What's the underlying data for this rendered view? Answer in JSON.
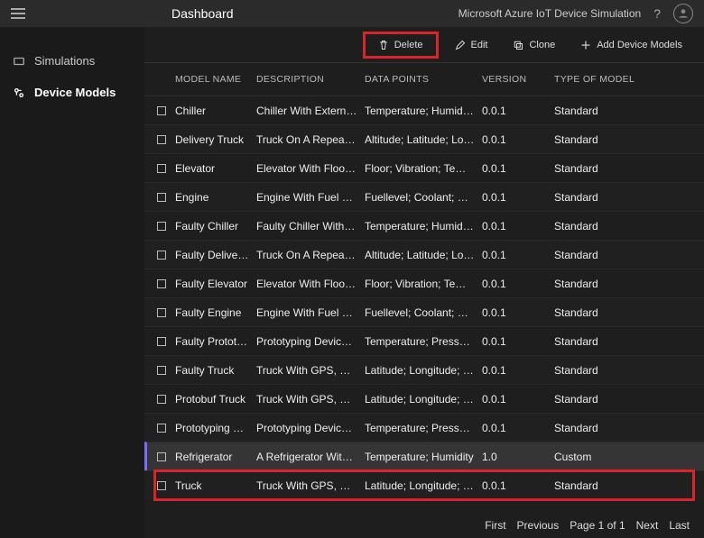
{
  "header": {
    "title": "Dashboard",
    "product": "Microsoft Azure IoT Device Simulation"
  },
  "sidebar": {
    "items": [
      {
        "label": "Simulations",
        "active": false
      },
      {
        "label": "Device Models",
        "active": true
      }
    ]
  },
  "toolbar": {
    "delete": "Delete",
    "edit": "Edit",
    "clone": "Clone",
    "add": "Add Device Models"
  },
  "columns": {
    "model": "MODEL NAME",
    "desc": "DESCRIPTION",
    "data": "DATA POINTS",
    "ver": "VERSION",
    "type": "TYPE OF MODEL"
  },
  "rows": [
    {
      "name": "Chiller",
      "desc": "Chiller With External T...",
      "data": "Temperature; Humidit...",
      "ver": "0.0.1",
      "type": "Standard",
      "selected": false
    },
    {
      "name": "Delivery Truck",
      "desc": "Truck On A Repeating...",
      "data": "Altitude; Latitude; Lon...",
      "ver": "0.0.1",
      "type": "Standard",
      "selected": false
    },
    {
      "name": "Elevator",
      "desc": "Elevator With Floor, Vi...",
      "data": "Floor; Vibration; Temp...",
      "ver": "0.0.1",
      "type": "Standard",
      "selected": false
    },
    {
      "name": "Engine",
      "desc": "Engine With Fuel Leve...",
      "data": "Fuellevel; Coolant; Vib...",
      "ver": "0.0.1",
      "type": "Standard",
      "selected": false
    },
    {
      "name": "Faulty Chiller",
      "desc": "Faulty Chiller With Wr...",
      "data": "Temperature; Humidit...",
      "ver": "0.0.1",
      "type": "Standard",
      "selected": false
    },
    {
      "name": "Faulty Delivery Tr...",
      "desc": "Truck On A Repeating...",
      "data": "Altitude; Latitude; Lon...",
      "ver": "0.0.1",
      "type": "Standard",
      "selected": false
    },
    {
      "name": "Faulty Elevator",
      "desc": "Elevator With Floor, Vi...",
      "data": "Floor; Vibration; Temp...",
      "ver": "0.0.1",
      "type": "Standard",
      "selected": false
    },
    {
      "name": "Faulty Engine",
      "desc": "Engine With Fuel Leve...",
      "data": "Fuellevel; Coolant; Vib...",
      "ver": "0.0.1",
      "type": "Standard",
      "selected": false
    },
    {
      "name": "Faulty Prototypin...",
      "desc": "Prototyping Device Wi...",
      "data": "Temperature; Pressure...",
      "ver": "0.0.1",
      "type": "Standard",
      "selected": false
    },
    {
      "name": "Faulty Truck",
      "desc": "Truck With GPS, Spee...",
      "data": "Latitude; Longitude; S...",
      "ver": "0.0.1",
      "type": "Standard",
      "selected": false
    },
    {
      "name": "Protobuf Truck",
      "desc": "Truck With GPS, Spee...",
      "data": "Latitude; Longitude; S...",
      "ver": "0.0.1",
      "type": "Standard",
      "selected": false
    },
    {
      "name": "Prototyping Device",
      "desc": "Prototyping Device Wi...",
      "data": "Temperature; Pressure...",
      "ver": "0.0.1",
      "type": "Standard",
      "selected": false
    },
    {
      "name": "Refrigerator",
      "desc": "A Refrigerator With Te...",
      "data": "Temperature; Humidity",
      "ver": "1.0",
      "type": "Custom",
      "selected": true
    },
    {
      "name": "Truck",
      "desc": "Truck With GPS, Spee...",
      "data": "Latitude; Longitude; S...",
      "ver": "0.0.1",
      "type": "Standard",
      "selected": false
    }
  ],
  "pager": {
    "first": "First",
    "prev": "Previous",
    "page": "Page 1 of 1",
    "next": "Next",
    "last": "Last"
  }
}
